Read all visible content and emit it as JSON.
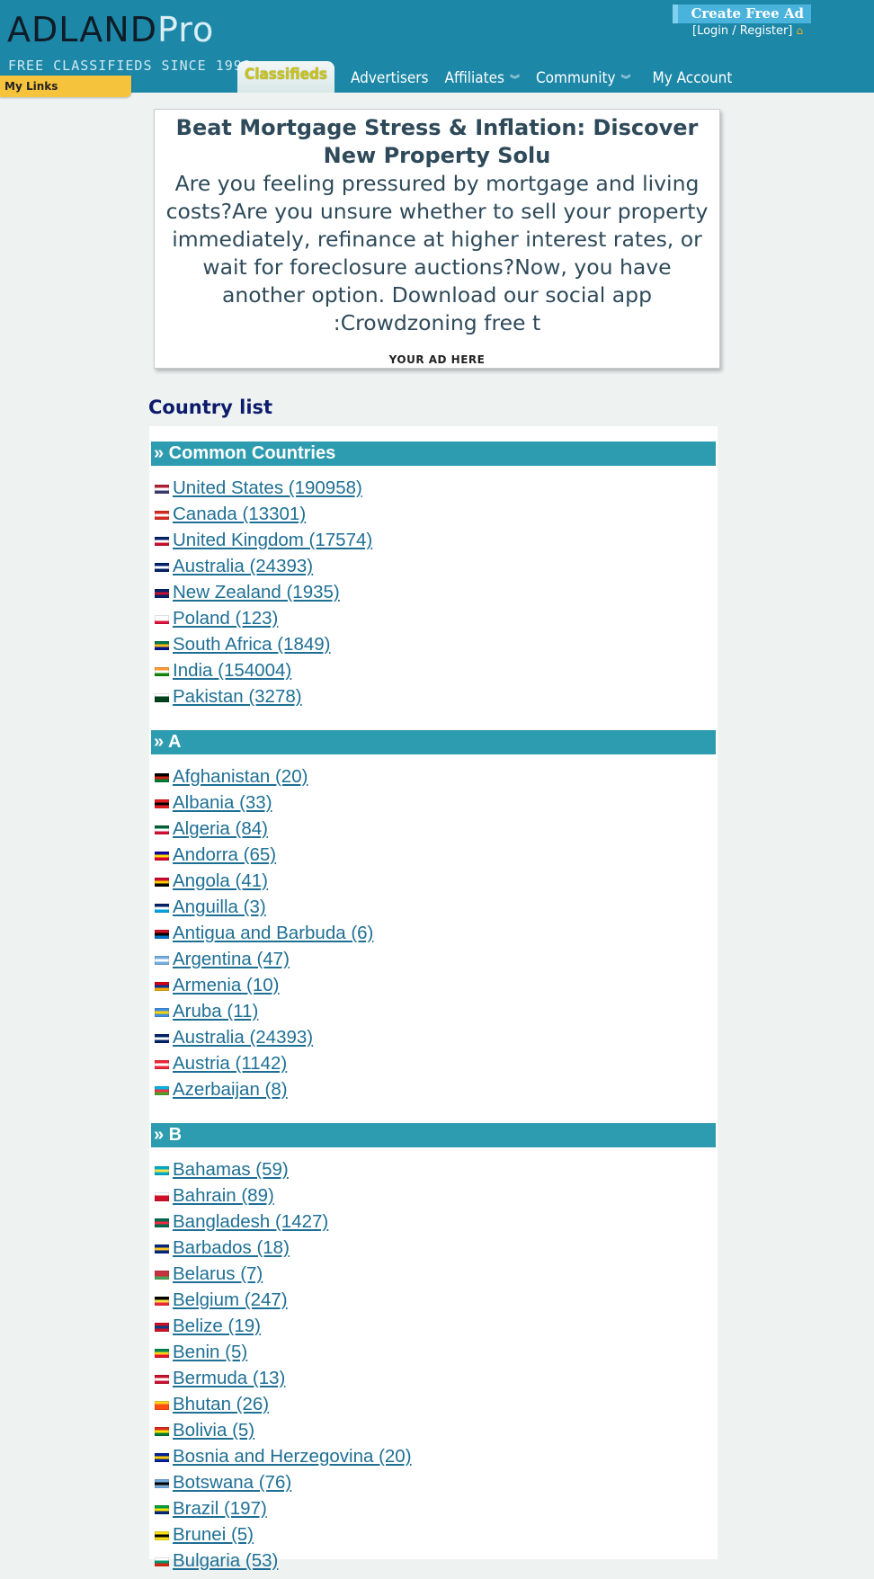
{
  "brand": {
    "logo_dark": "ADLAND",
    "logo_light": "Pro",
    "tagline": "FREE CLASSIFIEDS SINCE 1998"
  },
  "header": {
    "my_links": "My Links",
    "create_ad": "Create Free Ad",
    "login": "[Login / Register]",
    "nav": [
      {
        "label": "Classifieds",
        "chevron": ""
      },
      {
        "label": "Advertisers",
        "chevron": ""
      },
      {
        "label": "Affiliates",
        "chevron": "»"
      },
      {
        "label": "Community",
        "chevron": "»"
      },
      {
        "label": "My Account",
        "chevron": ""
      }
    ]
  },
  "ad": {
    "title": "Beat Mortgage Stress & Inflation: Discover New Property Solu",
    "body": "Are you feeling pressured by mortgage and living costs?Are you unsure whether to sell your property immediately, refinance at higher interest rates, or wait for foreclosure auctions?Now, you have another option. Download our social app :Crowdzoning free t",
    "footer": "YOUR AD HERE"
  },
  "country_list": {
    "title": "Country list",
    "groups": [
      {
        "header": "» Common Countries",
        "items": [
          {
            "text": "United States (190958)",
            "flag": [
              "#b22234",
              "#ffffff",
              "#3c3b6e"
            ]
          },
          {
            "text": "Canada (13301)",
            "flag": [
              "#d52b1e",
              "#ffffff",
              "#d52b1e"
            ]
          },
          {
            "text": "United Kingdom (17574)",
            "flag": [
              "#012169",
              "#ffffff",
              "#c8102e"
            ]
          },
          {
            "text": "Australia (24393)",
            "flag": [
              "#012169",
              "#ffffff",
              "#012169"
            ]
          },
          {
            "text": "New Zealand (1935)",
            "flag": [
              "#012169",
              "#c8102e",
              "#012169"
            ]
          },
          {
            "text": "Poland (123)",
            "flag": [
              "#ffffff",
              "#ffffff",
              "#dc143c"
            ]
          },
          {
            "text": "South Africa (1849)",
            "flag": [
              "#007749",
              "#ffb81c",
              "#001489"
            ]
          },
          {
            "text": "India (154004)",
            "flag": [
              "#ff9933",
              "#ffffff",
              "#138808"
            ]
          },
          {
            "text": "Pakistan (3278)",
            "flag": [
              "#ffffff",
              "#01411c",
              "#01411c"
            ]
          }
        ]
      },
      {
        "header": "» A",
        "items": [
          {
            "text": "Afghanistan (20)",
            "flag": [
              "#000000",
              "#d32011",
              "#007a36"
            ]
          },
          {
            "text": "Albania (33)",
            "flag": [
              "#e41e20",
              "#000000",
              "#e41e20"
            ]
          },
          {
            "text": "Algeria (84)",
            "flag": [
              "#006233",
              "#ffffff",
              "#d21034"
            ]
          },
          {
            "text": "Andorra (65)",
            "flag": [
              "#10069f",
              "#fedd00",
              "#d50032"
            ]
          },
          {
            "text": "Angola (41)",
            "flag": [
              "#cc092f",
              "#ffcb00",
              "#000000"
            ]
          },
          {
            "text": "Anguilla (3)",
            "flag": [
              "#012169",
              "#ffffff",
              "#00a3e0"
            ]
          },
          {
            "text": "Antigua and Barbuda (6)",
            "flag": [
              "#ce1126",
              "#000000",
              "#0072c6"
            ]
          },
          {
            "text": "Argentina (47)",
            "flag": [
              "#74acdf",
              "#ffffff",
              "#74acdf"
            ]
          },
          {
            "text": "Armenia (10)",
            "flag": [
              "#d90012",
              "#0033a0",
              "#f2a800"
            ]
          },
          {
            "text": "Aruba (11)",
            "flag": [
              "#418fde",
              "#ffd100",
              "#418fde"
            ]
          },
          {
            "text": "Australia (24393)",
            "flag": [
              "#012169",
              "#ffffff",
              "#012169"
            ]
          },
          {
            "text": "Austria (1142)",
            "flag": [
              "#ed2939",
              "#ffffff",
              "#ed2939"
            ]
          },
          {
            "text": "Azerbaijan (8)",
            "flag": [
              "#00b5e2",
              "#ef3340",
              "#509e2f"
            ]
          }
        ]
      },
      {
        "header": "» B",
        "items": [
          {
            "text": "Bahamas (59)",
            "flag": [
              "#00abc9",
              "#fae042",
              "#00abc9"
            ]
          },
          {
            "text": "Bahrain (89)",
            "flag": [
              "#ffffff",
              "#ce1126",
              "#ce1126"
            ]
          },
          {
            "text": "Bangladesh (1427)",
            "flag": [
              "#006a4e",
              "#f42a41",
              "#006a4e"
            ]
          },
          {
            "text": "Barbados (18)",
            "flag": [
              "#00267f",
              "#ffc726",
              "#00267f"
            ]
          },
          {
            "text": "Belarus (7)",
            "flag": [
              "#c8313e",
              "#c8313e",
              "#4aa657"
            ]
          },
          {
            "text": "Belgium (247)",
            "flag": [
              "#000000",
              "#fae042",
              "#ed2939"
            ]
          },
          {
            "text": "Belize (19)",
            "flag": [
              "#ce1126",
              "#003f87",
              "#ce1126"
            ]
          },
          {
            "text": "Benin (5)",
            "flag": [
              "#008751",
              "#fcd116",
              "#e8112d"
            ]
          },
          {
            "text": "Bermuda (13)",
            "flag": [
              "#c8102e",
              "#ffffff",
              "#c8102e"
            ]
          },
          {
            "text": "Bhutan (26)",
            "flag": [
              "#ffd520",
              "#ff4e12",
              "#ff4e12"
            ]
          },
          {
            "text": "Bolivia (5)",
            "flag": [
              "#d52b1e",
              "#f9e300",
              "#007934"
            ]
          },
          {
            "text": "Bosnia and Herzegovina (20)",
            "flag": [
              "#002395",
              "#fecb00",
              "#002395"
            ]
          },
          {
            "text": "Botswana (76)",
            "flag": [
              "#75aadb",
              "#000000",
              "#75aadb"
            ]
          },
          {
            "text": "Brazil (197)",
            "flag": [
              "#009c3b",
              "#ffdf00",
              "#002776"
            ]
          },
          {
            "text": "Brunei (5)",
            "flag": [
              "#f7e017",
              "#000000",
              "#f7e017"
            ]
          },
          {
            "text": "Bulgaria (53)",
            "flag": [
              "#ffffff",
              "#00966e",
              "#d62612"
            ]
          }
        ]
      }
    ]
  }
}
